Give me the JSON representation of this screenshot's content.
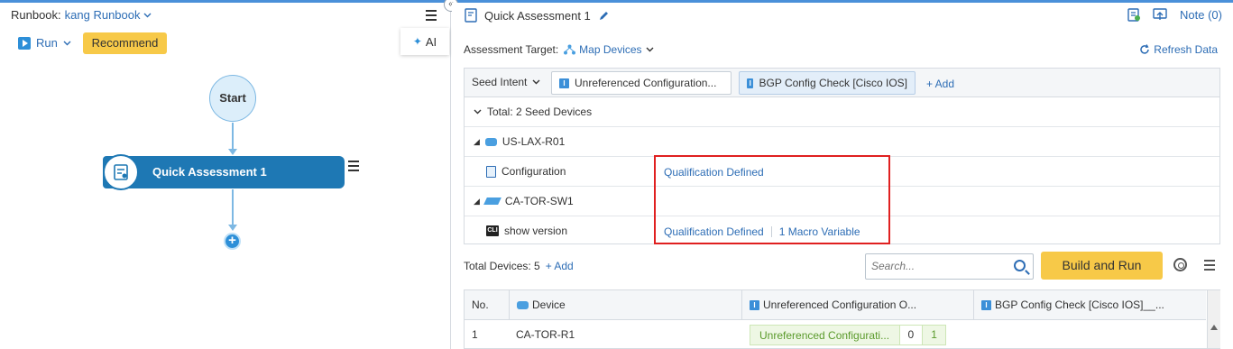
{
  "runbook": {
    "label": "Runbook:",
    "name": "kang Runbook",
    "run_label": "Run",
    "recommend_label": "Recommend",
    "ai_label": "AI",
    "start_label": "Start",
    "node_label": "Quick Assessment 1"
  },
  "assessment": {
    "title": "Quick Assessment 1",
    "note_label": "Note (0)",
    "target_label": "Assessment Target:",
    "map_devices_label": "Map Devices",
    "refresh_label": "Refresh Data"
  },
  "intents": {
    "seed_intent_label": "Seed Intent",
    "tabs": [
      {
        "label": "Unreferenced Configuration...",
        "badge": "I"
      },
      {
        "label": "BGP Config Check [Cisco IOS]",
        "badge": "I"
      }
    ],
    "add_label": "+ Add",
    "total_label": "Total: 2 Seed Devices",
    "rows": [
      {
        "type": "device",
        "label": "US-LAX-R01",
        "icon": "router-icon"
      },
      {
        "type": "item",
        "label": "Configuration",
        "icon": "config-icon",
        "qual": "Qualification Defined",
        "macro": ""
      },
      {
        "type": "device",
        "label": "CA-TOR-SW1",
        "icon": "switch-icon"
      },
      {
        "type": "item",
        "label": "show version",
        "icon": "cli-icon",
        "qual": "Qualification Defined",
        "macro": "1 Macro Variable"
      }
    ],
    "cli_badge": "CLI"
  },
  "devices": {
    "total_label": "Total Devices: 5",
    "add_label": "+ Add",
    "search_placeholder": "Search...",
    "build_run_label": "Build and Run",
    "columns": [
      "No.",
      "Device",
      "Unreferenced Configuration O...",
      "BGP Config Check [Cisco IOS]__..."
    ],
    "rows": [
      {
        "no": "1",
        "device": "CA-TOR-R1",
        "result_label": "Unreferenced Configurati...",
        "count_a": "0",
        "count_b": "1"
      }
    ]
  },
  "colors": {
    "accent": "#2d6db5",
    "button_yellow": "#f7c948",
    "node_blue": "#1e78b4",
    "highlight_red": "#e02020",
    "success_green": "#5a9a2b"
  }
}
